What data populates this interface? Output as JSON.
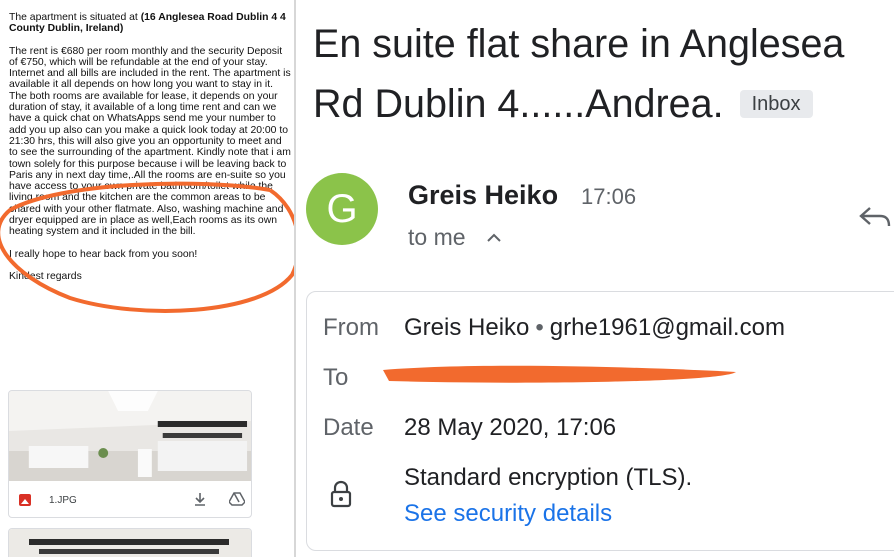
{
  "email_body": {
    "intro_prefix": "The apartment is situated at ",
    "intro_address": "(16 Anglesea Road Dublin 4 4 County Dublin, Ireland)",
    "paragraph": "The rent is €680 per room monthly and the security Deposit of €750, which will be refundable at the end of your stay. Internet and all bills are included in the rent. The apartment is available it all depends on how long you want to stay in it. The both rooms are available for lease, it depends on your duration of stay, it available of a long time rent and can we have a quick chat on WhatsApps send me your number to add you up also can you make a quick look today at 20:00 to 21:30 hrs, this will also give you an opportunity to meet and to see the surrounding of the apartment. Kindly note that i am town solely for this purpose because i will be leaving back to Paris any in next day time,.All the rooms are en-suite so you have access to your own private bathroom/toilet while the living room and the kitchen are the common areas to be shared with your other flatmate. Also, washing machine and dryer equipped are in place as well,Each rooms as its own heating system and it included in the bill.",
    "closing": "I really hope to hear back from you soon!",
    "signoff": "Kindest regards"
  },
  "attachment": {
    "filename": "1.JPG",
    "icons": [
      "image-file-icon",
      "download-icon",
      "drive-icon"
    ]
  },
  "header": {
    "subject": "En suite flat share in Anglesea Rd Dublin 4......Andrea.",
    "label": "Inbox",
    "avatar_letter": "G",
    "sender_name": "Greis Heiko",
    "time": "17:06",
    "to_me": "to me",
    "icons": [
      "chevron-up-icon",
      "reply-icon"
    ]
  },
  "details": {
    "from_label": "From",
    "from_name": "Greis Heiko",
    "from_separator": "•",
    "from_email": "grhe1961@gmail.com",
    "to_label": "To",
    "date_label": "Date",
    "date_value": "28 May 2020, 17:06",
    "encryption": "Standard encryption (TLS).",
    "security_link": "See security details",
    "icons": [
      "lock-icon"
    ]
  },
  "colors": {
    "avatar_bg": "#8bc34a",
    "link": "#1a73e8",
    "annotation": "#f26a2e"
  }
}
